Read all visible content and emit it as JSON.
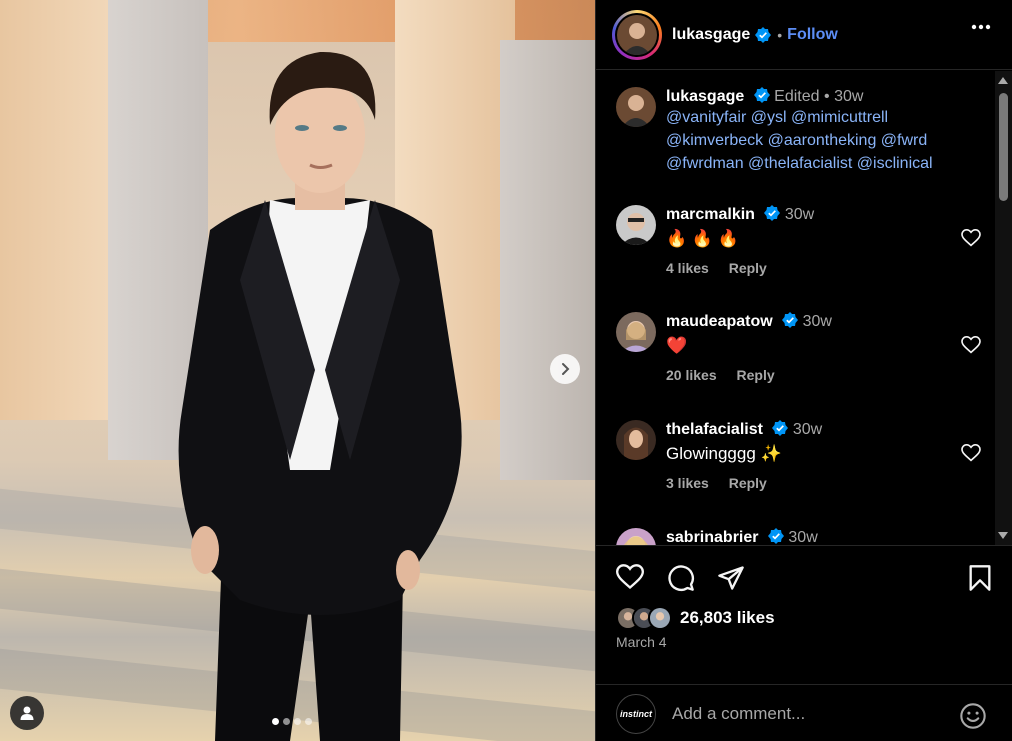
{
  "post": {
    "username": "lukasgage",
    "follow_label": "Follow",
    "separator": "•",
    "more_icon": "more-horizontal-icon",
    "carousel": {
      "current_index": 1,
      "total": 4
    }
  },
  "caption": {
    "username": "lukasgage",
    "edited_label": "Edited",
    "separator": "•",
    "time": "30w",
    "mentions": "@vanityfair  @ysl @mimicuttrell @kimverbeck  @aarontheking @fwrd @fwrdman @thelafacialist @isclinical"
  },
  "comments": [
    {
      "username": "marcmalkin",
      "time": "30w",
      "text": "🔥 🔥 🔥",
      "likes": "4 likes",
      "reply": "Reply"
    },
    {
      "username": "maudeapatow",
      "time": "30w",
      "text": "❤️",
      "likes": "20 likes",
      "reply": "Reply"
    },
    {
      "username": "thelafacialist",
      "time": "30w",
      "text": "Glowingggg ✨",
      "likes": "3 likes",
      "reply": "Reply"
    },
    {
      "username": "sabrinabrier",
      "time": "30w"
    }
  ],
  "footer": {
    "likes": "26,803 likes",
    "date": "March 4",
    "add_comment_placeholder": "Add a comment...",
    "commenter_avatar_text": "instinct"
  },
  "colors": {
    "link": "#5c8df5",
    "verified": "#0095f6",
    "background": "#000000"
  }
}
